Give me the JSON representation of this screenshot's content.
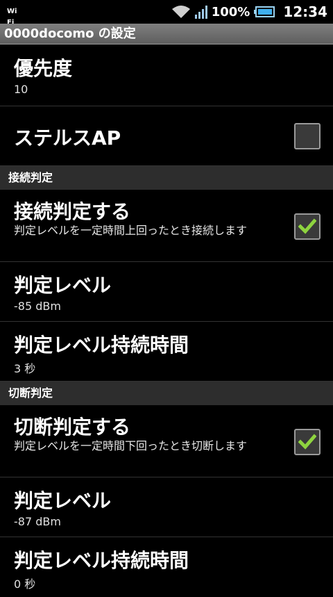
{
  "status_bar": {
    "wifi_label": "Wi Fi",
    "battery_percent": "100%",
    "time": "12:34",
    "icons": [
      "wifi-signal-icon",
      "cell-signal-icon",
      "battery-icon"
    ]
  },
  "title_bar": {
    "title": "0000docomo の設定"
  },
  "rows": {
    "priority": {
      "title": "優先度",
      "value": "10"
    },
    "stealth_ap": {
      "title": "ステルスAP",
      "checked": false
    }
  },
  "connect_section": {
    "header": "接続判定",
    "enable": {
      "title": "接続判定する",
      "desc": "判定レベルを一定時間上回ったとき接続します",
      "checked": true
    },
    "level": {
      "title": "判定レベル",
      "value": "-85 dBm"
    },
    "duration": {
      "title": "判定レベル持続時間",
      "value": "3 秒"
    }
  },
  "disconnect_section": {
    "header": "切断判定",
    "enable": {
      "title": "切断判定する",
      "desc": "判定レベルを一定時間下回ったとき切断します",
      "checked": true
    },
    "level": {
      "title": "判定レベル",
      "value": "-87 dBm"
    },
    "duration": {
      "title": "判定レベル持続時間",
      "value": "0 秒"
    }
  },
  "colors": {
    "check_green": "#8ed43f",
    "section_bg": "#2d2d2d",
    "title_bar_bg": "#6e6e6e"
  }
}
